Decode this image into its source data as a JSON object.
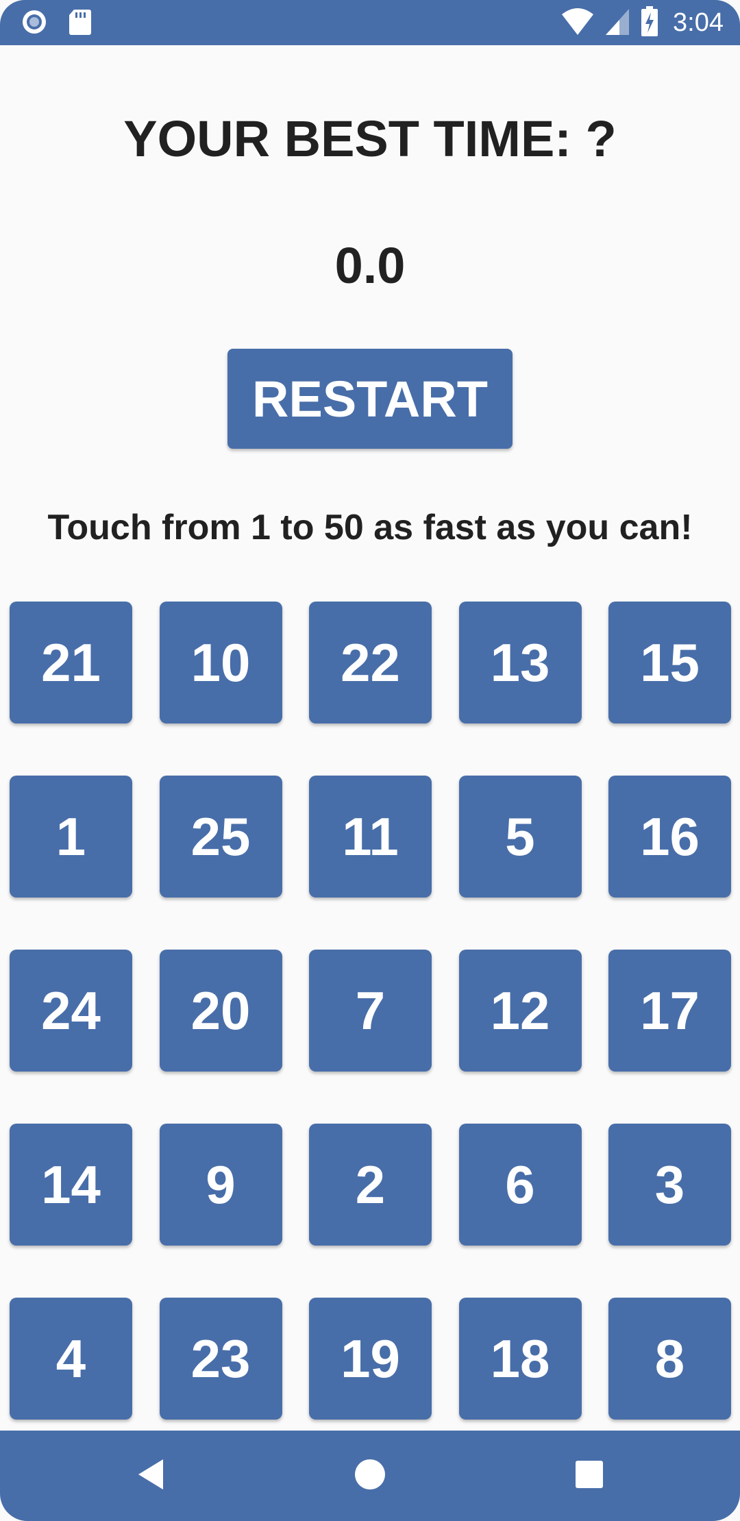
{
  "status_bar": {
    "time": "3:04",
    "icons": [
      "record-icon",
      "sd-card-icon",
      "wifi-icon",
      "signal-icon",
      "battery-charging-icon"
    ]
  },
  "header": {
    "best_time_label": "YOUR BEST TIME: ?",
    "timer_value": "0.0",
    "restart_label": "RESTART",
    "instructions": "Touch from 1 to 50 as fast as you can!"
  },
  "grid": {
    "tiles": [
      "21",
      "10",
      "22",
      "13",
      "15",
      "1",
      "25",
      "11",
      "5",
      "16",
      "24",
      "20",
      "7",
      "12",
      "17",
      "14",
      "9",
      "2",
      "6",
      "3",
      "4",
      "23",
      "19",
      "18",
      "8"
    ]
  },
  "nav_bar": {
    "icons": [
      "back-icon",
      "home-icon",
      "recents-icon"
    ]
  },
  "colors": {
    "primary": "#486ea9",
    "background": "#fafafa",
    "text": "#212121"
  }
}
